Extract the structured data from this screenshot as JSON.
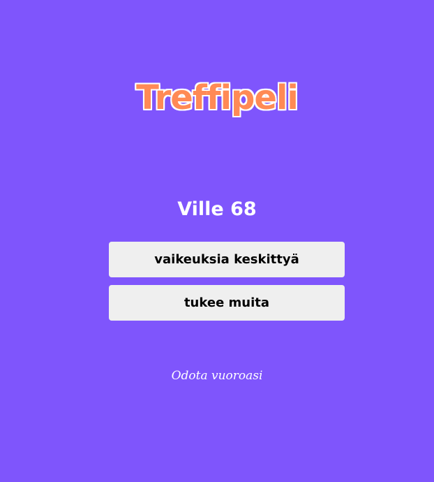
{
  "game": {
    "title": "Treffipeli",
    "player": "Ville 68",
    "choices": [
      {
        "label": "vaikeuksia keskittyä"
      },
      {
        "label": "tukee muita"
      }
    ],
    "status": "Odota vuoroasi"
  },
  "colors": {
    "background": "#7f55fc",
    "title": "#ff8a55",
    "title_outline": "#ffffff",
    "button_bg": "#efefef",
    "text_light": "#ffffff"
  }
}
